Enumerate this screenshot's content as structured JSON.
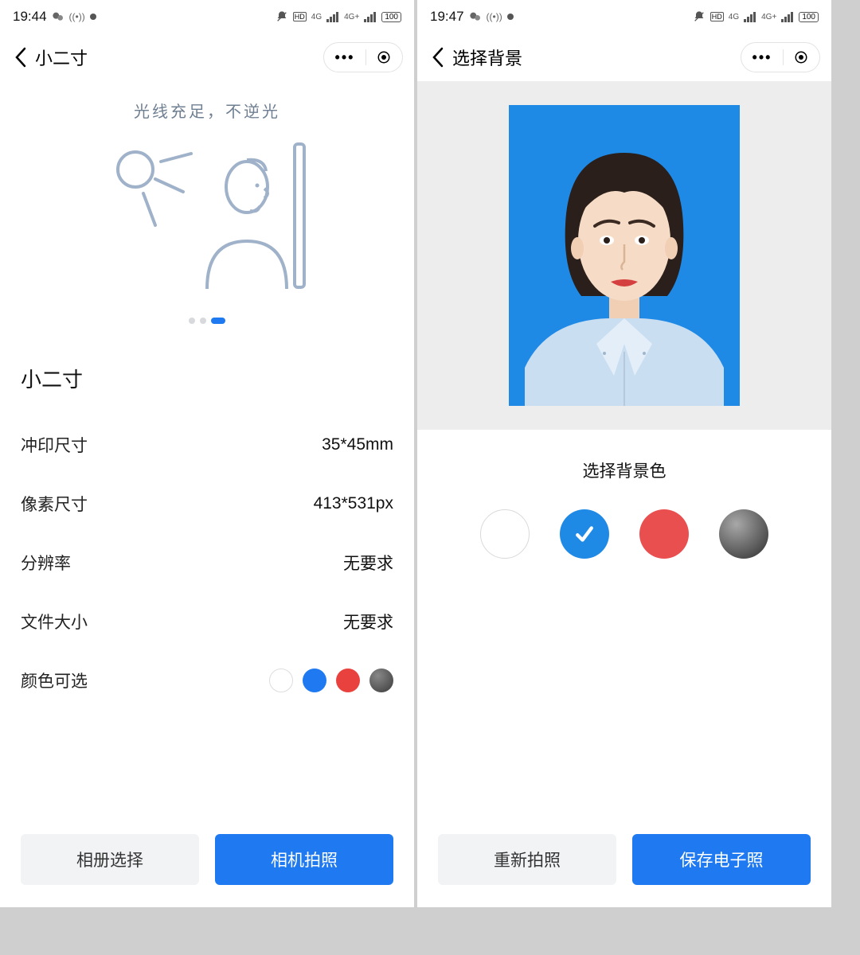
{
  "left": {
    "statusbar": {
      "time": "19:44",
      "battery": "100"
    },
    "nav": {
      "title": "小二寸"
    },
    "hint": "光线充足，不逆光",
    "section_title": "小二寸",
    "specs": {
      "print_label": "冲印尺寸",
      "print_value": "35*45mm",
      "pixel_label": "像素尺寸",
      "pixel_value": "413*531px",
      "dpi_label": "分辨率",
      "dpi_value": "无要求",
      "size_label": "文件大小",
      "size_value": "无要求",
      "color_label": "颜色可选"
    },
    "colors": [
      "white",
      "blue",
      "red",
      "gradient"
    ],
    "buttons": {
      "album": "相册选择",
      "camera": "相机拍照"
    }
  },
  "right": {
    "statusbar": {
      "time": "19:47",
      "battery": "100"
    },
    "nav": {
      "title": "选择背景"
    },
    "bg_title": "选择背景色",
    "bg_options": [
      "white",
      "blue",
      "red",
      "gradient"
    ],
    "selected_bg": "blue",
    "buttons": {
      "retake": "重新拍照",
      "save": "保存电子照"
    }
  }
}
